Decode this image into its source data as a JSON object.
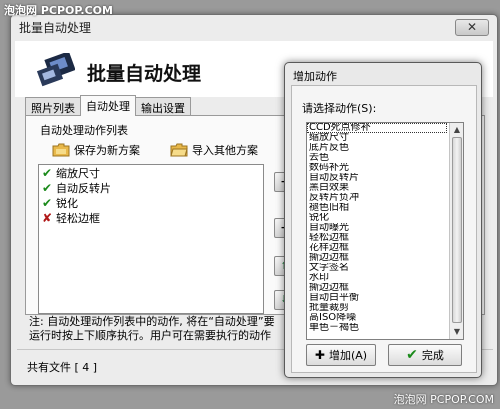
{
  "watermark": {
    "top": "泡泡网 PCPOP.COM",
    "bottom": "泡泡网 PCPOP.COM"
  },
  "main_window": {
    "title": "批量自动处理",
    "close_label": "✕",
    "heading": "批量自动处理",
    "tabs": [
      {
        "label": "照片列表"
      },
      {
        "label": "自动处理"
      },
      {
        "label": "输出设置"
      }
    ],
    "panel_label": "自动处理动作列表",
    "save_plan_label": "保存为新方案",
    "import_plan_label": "导入其他方案",
    "actions": [
      {
        "label": "缩放尺寸",
        "status": "enabled"
      },
      {
        "label": "自动反转片",
        "status": "enabled"
      },
      {
        "label": "锐化",
        "status": "enabled"
      },
      {
        "label": "轻松边框",
        "status": "disabled"
      }
    ],
    "side_buttons": [
      {
        "label": "+"
      },
      {
        "label": "−"
      },
      {
        "label": "⇧"
      },
      {
        "label": "⇩"
      }
    ],
    "note_lines": [
      "注: 自动处理动作列表中的动作, 将在“自动处理”要",
      "运行时按上下顺序执行。用户可在需要执行的动作"
    ],
    "file_count": "共有文件 [ 4 ]"
  },
  "dialog": {
    "title": "增加动作",
    "select_label": "请选择动作(S):",
    "options": [
      "CCD死点修补",
      "缩放尺寸",
      "底片反色",
      "去色",
      "数码补光",
      "自动反转片",
      "黑白效果",
      "反转片负冲",
      "褪色旧相",
      "锐化",
      "自动曝光",
      "轻松边框",
      "花样边框",
      "撕边边框",
      "文字签名",
      "水印",
      "撕边边框",
      "自动白平衡",
      "批量裁剪",
      "高ISO降噪",
      "单色－褐色"
    ],
    "selected_index": 0,
    "add_label": "增加(A)",
    "done_label": "完成"
  },
  "colors": {
    "ok": "#1a8a1a",
    "no": "#b01818",
    "selection": "#333333"
  }
}
